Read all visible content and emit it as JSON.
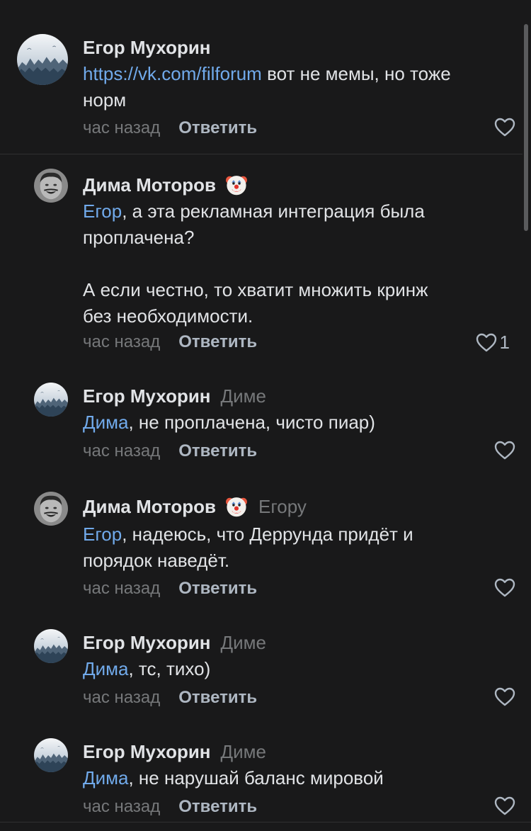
{
  "comments": [
    {
      "author": "Егор Мухорин",
      "reply_to": "",
      "mention": "https://vk.com/filforum",
      "text": " вот не мемы, но тоже\nнорм",
      "time": "час назад",
      "reply_label": "Ответить",
      "likes": ""
    },
    {
      "author": "Дима Моторов",
      "reply_to": "",
      "mention": "Егор",
      "text": ", а эта рекламная интеграция была\nпроплачена?\n\nА если честно, то хватит множить кринж\nбез необходимости.",
      "time": "час назад",
      "reply_label": "Ответить",
      "likes": "1"
    },
    {
      "author": "Егор Мухорин",
      "reply_to": "Диме",
      "mention": "Дима",
      "text": ", не проплачена, чисто пиар)",
      "time": "час назад",
      "reply_label": "Ответить",
      "likes": ""
    },
    {
      "author": "Дима Моторов",
      "reply_to": "Егору",
      "mention": "Егор",
      "text": ", надеюсь, что Деррунда придёт и\nпорядок наведёт.",
      "time": "час назад",
      "reply_label": "Ответить",
      "likes": ""
    },
    {
      "author": "Егор Мухорин",
      "reply_to": "Диме",
      "mention": "Дима",
      "text": ", тс, тихо)",
      "time": "час назад",
      "reply_label": "Ответить",
      "likes": ""
    },
    {
      "author": "Егор Мухорин",
      "reply_to": "Диме",
      "mention": "Дима",
      "text": ", не нарушай баланс мировой",
      "time": "час назад",
      "reply_label": "Ответить",
      "likes": ""
    }
  ],
  "icons": {
    "like": "heart-outline-icon",
    "badge": "clown-emoji-icon"
  },
  "colors": {
    "background": "#19191a",
    "link": "#71aaeb",
    "muted": "#76787a"
  }
}
